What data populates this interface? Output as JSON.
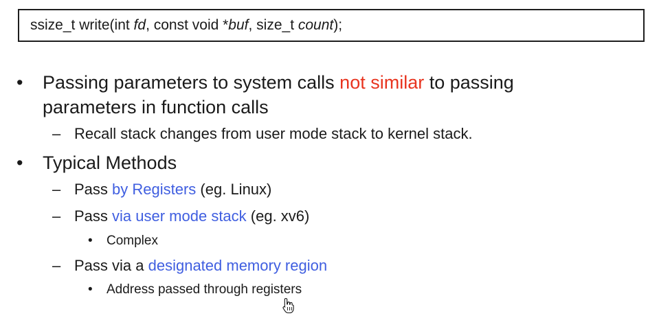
{
  "signature": {
    "part1": "ssize_t write(int ",
    "arg1": "fd",
    "part2": ", const void *",
    "arg2": "buf",
    "part3": ", size_t ",
    "arg3": "count",
    "part4": ");"
  },
  "markers": {
    "bullet": "•",
    "dash": "–",
    "sub_bullet": "•"
  },
  "bullets": [
    {
      "line1_before": "Passing parameters to system calls ",
      "line1_highlight": "not similar",
      "line1_after": " to passing",
      "line2": "parameters in function calls",
      "sub": [
        {
          "text": "Recall stack changes from user mode stack to kernel stack."
        }
      ]
    },
    {
      "text": "Typical Methods",
      "sub": [
        {
          "before": "Pass ",
          "highlight": "by Registers",
          "after": " (eg. Linux)"
        },
        {
          "before": "Pass ",
          "highlight": "via user mode stack",
          "after": " (eg. xv6)",
          "sub": [
            "Complex"
          ]
        },
        {
          "before": "Pass via a ",
          "highlight": "designated memory region",
          "after": "",
          "sub": [
            "Address passed through registers"
          ]
        }
      ]
    }
  ],
  "colors": {
    "highlight_red": "#e8341f",
    "highlight_blue": "#3f5ee0"
  },
  "icons": {
    "cursor": "hand-pointer-icon"
  }
}
